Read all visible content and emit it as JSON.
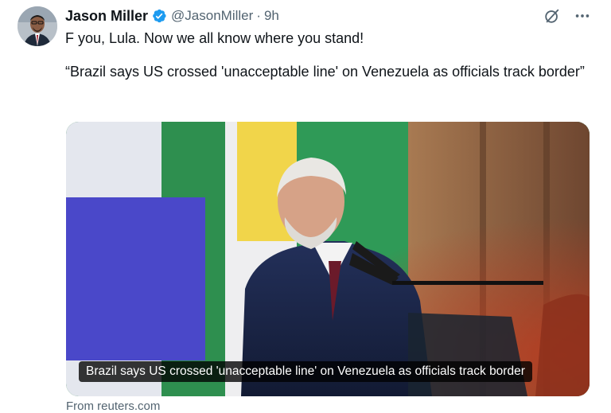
{
  "author": {
    "display_name": "Jason Miller",
    "handle": "@JasonMiller",
    "timestamp": "9h",
    "verified": true,
    "avatar_icon": "profile-photo"
  },
  "tweet": {
    "line1": "F you, Lula. Now we all know where you stand!",
    "line2": "“Brazil says US crossed 'unacceptable line' on Venezuela as officials track border”"
  },
  "media": {
    "caption": "Brazil says US crossed 'unacceptable line' on Venezuela as officials track border",
    "source": "From reuters.com"
  },
  "icons": {
    "grok": "grok-icon",
    "more": "more-icon",
    "verified": "verified-badge-icon"
  },
  "colors": {
    "verified_blue": "#1d9bf0",
    "secondary_text": "#536471"
  }
}
